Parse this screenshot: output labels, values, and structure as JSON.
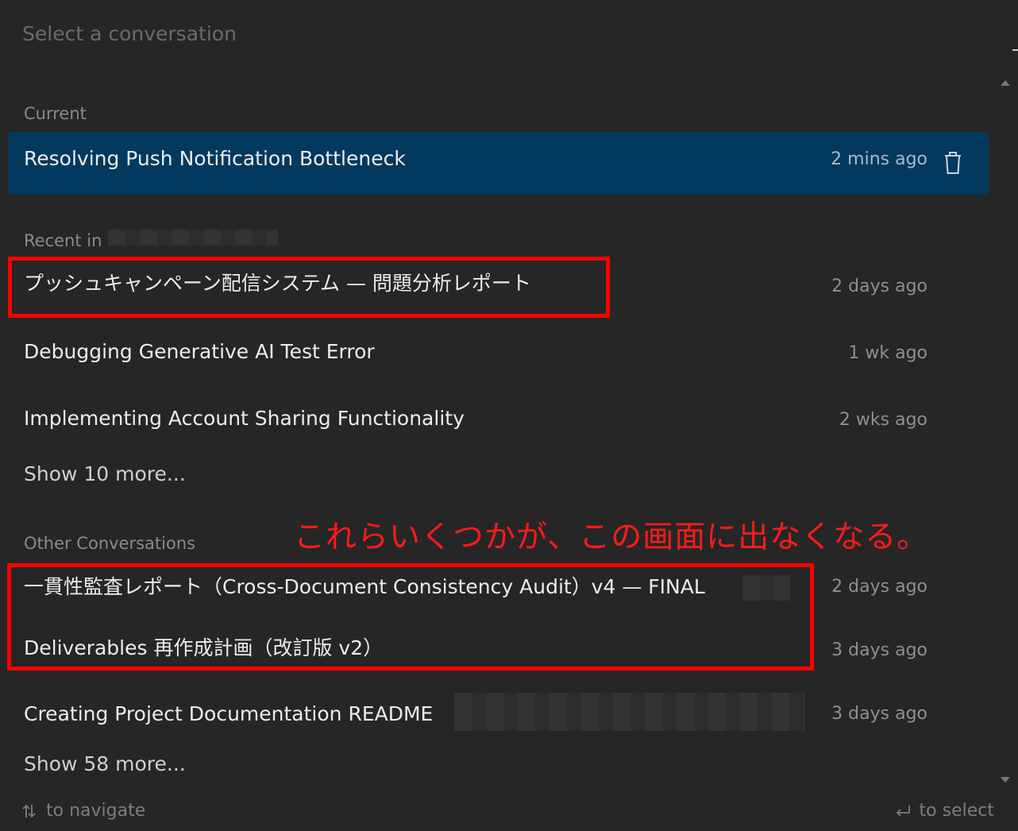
{
  "search": {
    "placeholder": "Select a conversation",
    "value": ""
  },
  "current": {
    "label": "Current",
    "title": "Resolving Push Notification Bottleneck",
    "time": "2 mins ago"
  },
  "recent": {
    "label": "Recent in",
    "items": [
      {
        "title": "プッシュキャンペーン配信システム — 問題分析レポート",
        "time": "2 days ago"
      },
      {
        "title": "Debugging Generative AI Test Error",
        "time": "1 wk ago"
      },
      {
        "title": "Implementing Account Sharing Functionality",
        "time": "2 wks ago"
      }
    ],
    "show_more": "Show 10 more..."
  },
  "other": {
    "label": "Other Conversations",
    "items": [
      {
        "title": "一貫性監査レポート（Cross-Document Consistency Audit）v4 — FINAL",
        "time": "2 days ago"
      },
      {
        "title": "Deliverables 再作成計画（改訂版 v2）",
        "time": "3 days ago"
      },
      {
        "title": "Creating Project Documentation README",
        "time": "3 days ago"
      }
    ],
    "show_more": "Show 58 more..."
  },
  "annotation": "これらいくつかが、この画面に出なくなる。",
  "footer": {
    "navigate": "to navigate",
    "select": "to select"
  },
  "colors": {
    "background": "#262626",
    "selected_row": "#03395e",
    "annotation_red": "#ff0000"
  },
  "icons": {
    "trash": "trash-icon",
    "navigate": "updown-arrows-icon",
    "select": "return-arrow-icon"
  }
}
